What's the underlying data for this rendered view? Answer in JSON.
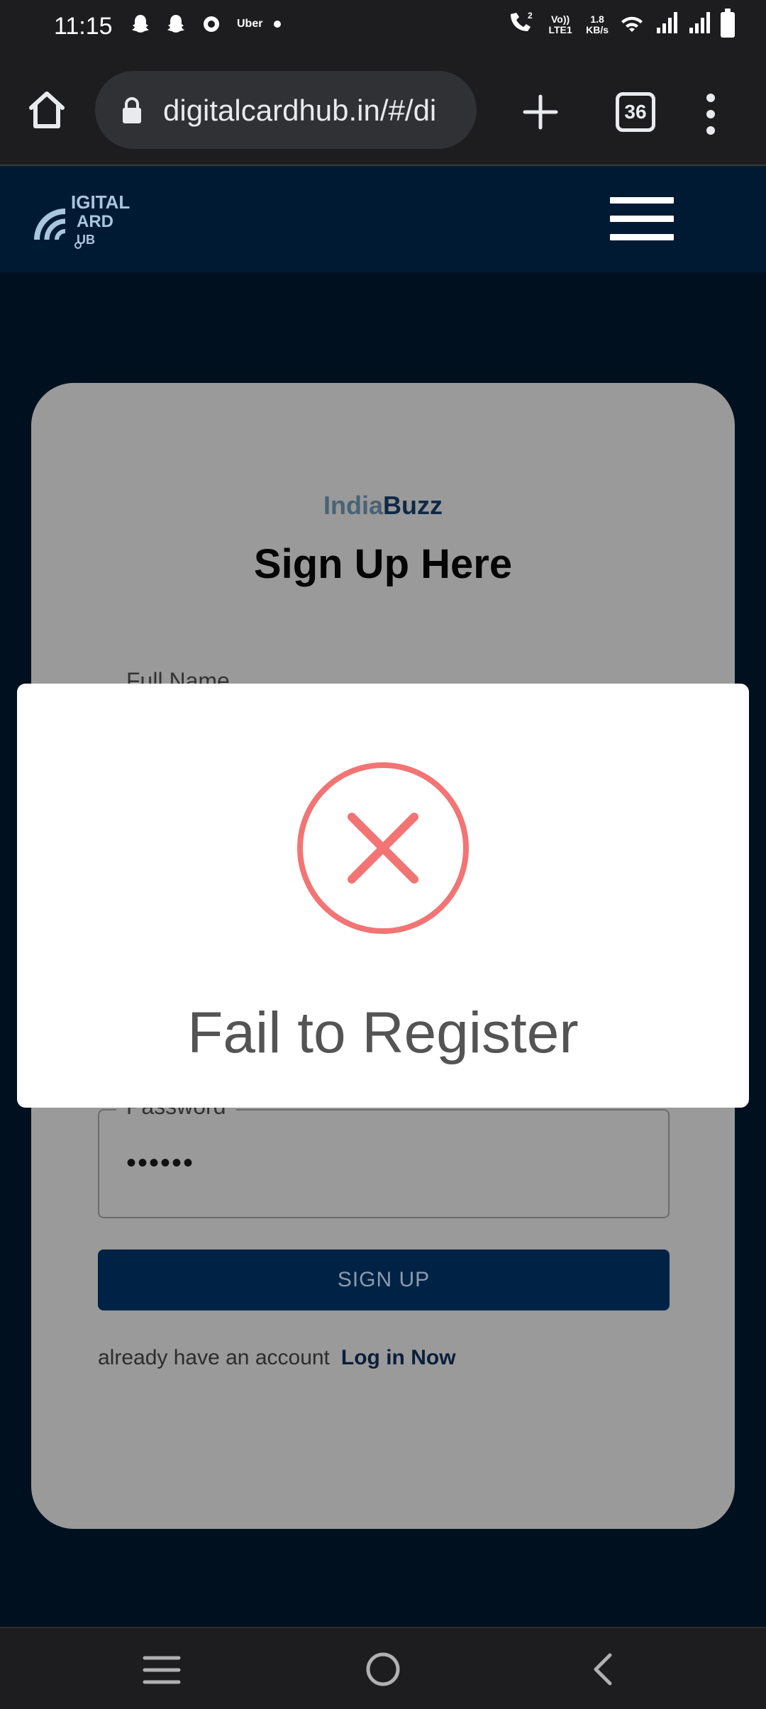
{
  "status_bar": {
    "time": "11:15",
    "uber_label": "Uber",
    "network_speed_top": "1.8",
    "network_speed_unit": "KB/s",
    "volte_label": "Vo)) LTE1",
    "sim_slot": "2",
    "icons": [
      "snapchat-icon",
      "snapchat-icon",
      "app-notification-icon",
      "uber-icon",
      "dot-icon",
      "wifi-calling-icon",
      "volte-icon",
      "wifi-icon",
      "signal-icon",
      "signal-icon",
      "battery-icon"
    ]
  },
  "browser": {
    "url": "digitalcardhub.in/#/di",
    "tab_count": "36",
    "icons": [
      "home-icon",
      "lock-icon",
      "new-tab-icon",
      "tabs-icon",
      "more-menu-icon"
    ]
  },
  "site": {
    "logo_text": "DIGITAL CARD HUB",
    "menu_icon": "hamburger-menu-icon"
  },
  "signup": {
    "brand_part1": "India",
    "brand_part2": "Buzz",
    "title": "Sign Up Here",
    "full_name_label": "Full Name",
    "password_label": "Password",
    "password_value": "••••••",
    "submit_label": "SIGN UP",
    "account_prompt": "already have an account",
    "login_link": "Log in Now"
  },
  "modal": {
    "icon": "error-x-icon",
    "title": "Fail to Register",
    "accent_color": "#f27474"
  },
  "nav_bar": {
    "icons": [
      "recent-apps-icon",
      "home-circle-icon",
      "back-icon"
    ]
  }
}
